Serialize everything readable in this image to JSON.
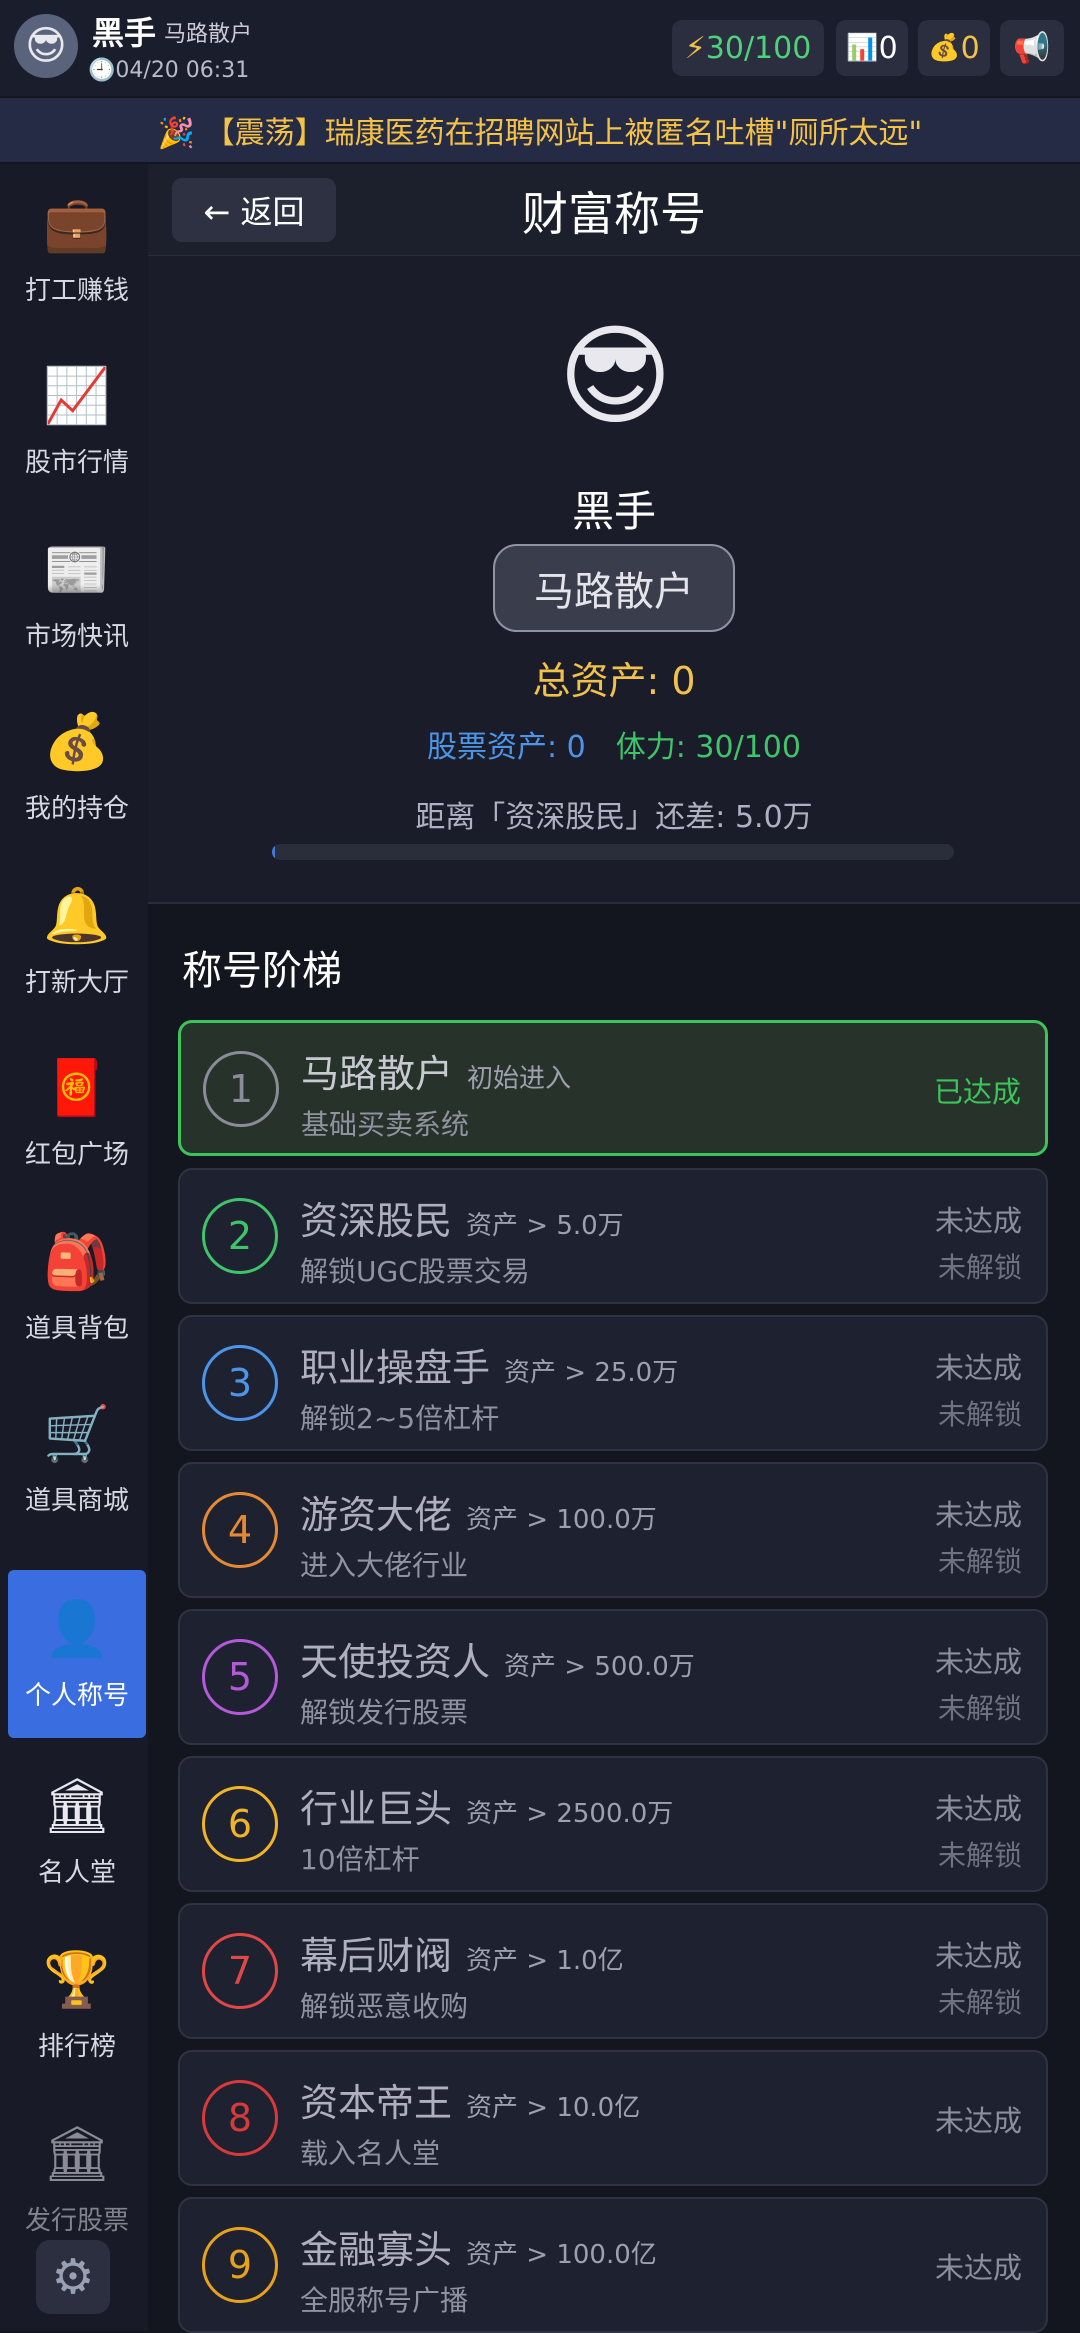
{
  "topbar": {
    "user_name": "黑手",
    "user_title": "马路散户",
    "datetime": "04/20 06:31",
    "energy": "30/100",
    "stock_count": "0",
    "coins": "0"
  },
  "banner": {
    "text": "🎉 【震荡】瑞康医药在招聘网站上被匿名吐槽\"厕所太远\""
  },
  "sidebar": {
    "items": [
      {
        "label": "打工赚钱",
        "icon": "briefcase-icon"
      },
      {
        "label": "股市行情",
        "icon": "chart-icon"
      },
      {
        "label": "市场快讯",
        "icon": "newspaper-icon"
      },
      {
        "label": "我的持仓",
        "icon": "money-bag-icon"
      },
      {
        "label": "打新大厅",
        "icon": "bell-icon"
      },
      {
        "label": "红包广场",
        "icon": "red-envelope-icon"
      },
      {
        "label": "道具背包",
        "icon": "backpack-icon"
      },
      {
        "label": "道具商城",
        "icon": "cart-icon"
      },
      {
        "label": "个人称号",
        "icon": "person-icon"
      },
      {
        "label": "名人堂",
        "icon": "bank-icon"
      },
      {
        "label": "排行榜",
        "icon": "trophy-icon"
      },
      {
        "label": "发行股票",
        "icon": "building-icon"
      }
    ]
  },
  "header": {
    "back_label": "← 返回",
    "title": "财富称号"
  },
  "profile": {
    "name": "黑手",
    "title_badge": "马路散户",
    "total_assets": "总资产: 0",
    "stock_assets": "股票资产: 0",
    "stamina": "体力: 30/100",
    "next_gap": "距离「资深股民」还差: 5.0万",
    "progress": 0.005
  },
  "ladder": {
    "title": "称号阶梯",
    "items": [
      {
        "num": "1",
        "name": "马路散户",
        "req": "初始进入",
        "desc": "基础买卖系统",
        "status": "已达成",
        "lock": "",
        "color": "#8a8d98"
      },
      {
        "num": "2",
        "name": "资深股民",
        "req": "资产 > 5.0万",
        "desc": "解锁UGC股票交易",
        "status": "未达成",
        "lock": "未解锁",
        "color": "#3fc46a"
      },
      {
        "num": "3",
        "name": "职业操盘手",
        "req": "资产 > 25.0万",
        "desc": "解锁2~5倍杠杆",
        "status": "未达成",
        "lock": "未解锁",
        "color": "#4d95e8"
      },
      {
        "num": "4",
        "name": "游资大佬",
        "req": "资产 > 100.0万",
        "desc": "进入大佬行业",
        "status": "未达成",
        "lock": "未解锁",
        "color": "#e58a34"
      },
      {
        "num": "5",
        "name": "天使投资人",
        "req": "资产 > 500.0万",
        "desc": "解锁发行股票",
        "status": "未达成",
        "lock": "未解锁",
        "color": "#b45ad8"
      },
      {
        "num": "6",
        "name": "行业巨头",
        "req": "资产 > 2500.0万",
        "desc": "10倍杠杆",
        "status": "未达成",
        "lock": "未解锁",
        "color": "#f0b429"
      },
      {
        "num": "7",
        "name": "幕后财阀",
        "req": "资产 > 1.0亿",
        "desc": "解锁恶意收购",
        "status": "未达成",
        "lock": "未解锁",
        "color": "#e04848"
      },
      {
        "num": "8",
        "name": "资本帝王",
        "req": "资产 > 10.0亿",
        "desc": "载入名人堂",
        "status": "未达成",
        "lock": "",
        "color": "#d83a3a"
      },
      {
        "num": "9",
        "name": "金融寡头",
        "req": "资产 > 100.0亿",
        "desc": "全服称号广播",
        "status": "未达成",
        "lock": "",
        "color": "#e6a21a"
      }
    ]
  }
}
